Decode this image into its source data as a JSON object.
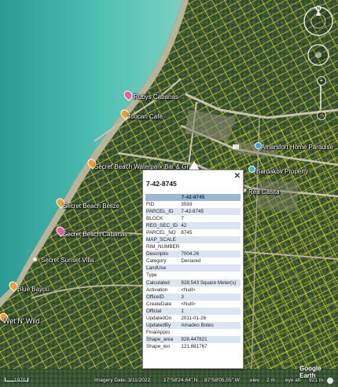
{
  "map": {
    "places": [
      {
        "name": "Rubys Cabanas",
        "type": "pink"
      },
      {
        "name": "Toucan Cafe",
        "type": "orange"
      },
      {
        "name": "Secret Beach Waterpark Bar & Grill",
        "type": "orange"
      },
      {
        "name": "Secret Beach Belize",
        "type": "orange"
      },
      {
        "name": "Secret Beach Cabanas",
        "type": "pink"
      },
      {
        "name": "Secret Sunset Villa",
        "type": "white"
      },
      {
        "name": "Blue Bayou",
        "type": "orange"
      },
      {
        "name": "Wet N' Wild",
        "type": "orange"
      },
      {
        "name": "Amarsfort Home Paradise",
        "type": "blue"
      },
      {
        "name": "Bardakov Property",
        "type": "cyan"
      },
      {
        "name": "Rea Casita",
        "type": "white"
      }
    ],
    "attribution": "Google Earth",
    "north_label": "N"
  },
  "popup": {
    "title": "7-42-8745",
    "header": "7-42-8745",
    "rows": [
      {
        "k": "FID",
        "v": "3593"
      },
      {
        "k": "PARCEL_ID",
        "v": "7-42-8745"
      },
      {
        "k": "BLOCK",
        "v": "7"
      },
      {
        "k": "REG_SEC_ID",
        "v": "42"
      },
      {
        "k": "PARCEL_NO",
        "v": "8745"
      },
      {
        "k": "MAP_SCALE",
        "v": ""
      },
      {
        "k": "RIM_NUMBER",
        "v": ""
      },
      {
        "k": "Descriptio",
        "v": "7004.26"
      },
      {
        "k": "Category",
        "v": "Declared"
      },
      {
        "k": "LandUse",
        "v": ""
      },
      {
        "k": "Type",
        "v": ""
      },
      {
        "k": "Calculated",
        "v": "928.543 Square Meter(s)"
      },
      {
        "k": "Activation",
        "v": "<Null>"
      },
      {
        "k": "OfficeID",
        "v": "3"
      },
      {
        "k": "CreateDate",
        "v": "<Null>"
      },
      {
        "k": "Official",
        "v": "1"
      },
      {
        "k": "UpdatedOn",
        "v": "2011-01-26"
      },
      {
        "k": "UpdatedBy",
        "v": "Amadeo Botes"
      },
      {
        "k": "FinalAppro",
        "v": ""
      },
      {
        "k": "Shape_area",
        "v": "928.447821"
      },
      {
        "k": "Shape_len",
        "v": "121.881767"
      }
    ]
  },
  "status": {
    "scale": "1970",
    "imagery_date": "Imagery Date: 3/11/2022",
    "lat": "17°58'24.64\" N",
    "lon": "87°58'05.55\" W",
    "elev_label": "elev",
    "elev": "2 m",
    "eye_alt_label": "eye alt",
    "eye_alt": "921 m"
  },
  "colors": {
    "parcel_lines": "#e8e020",
    "water": "#3fb0a8",
    "land": "#3d5a36"
  }
}
